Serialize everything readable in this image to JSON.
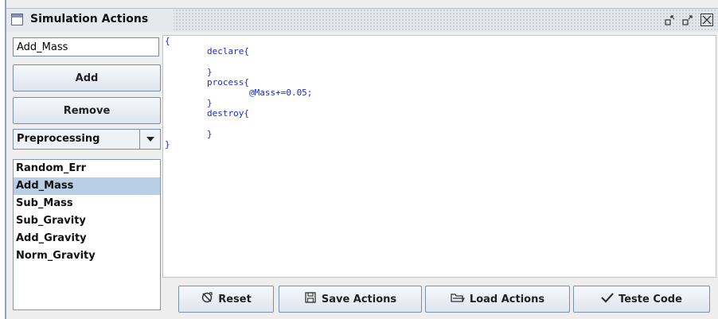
{
  "window": {
    "title": "Simulation Actions",
    "minimize_icon": "▫ʼ",
    "maximize_icon": "▫↗",
    "close_icon": "☒"
  },
  "left_panel": {
    "name_input_value": "Add_Mass",
    "add_label": "Add",
    "remove_label": "Remove",
    "stage_select": "Preprocessing",
    "actions": [
      "Random_Err",
      "Add_Mass",
      "Sub_Mass",
      "Sub_Gravity",
      "Add_Gravity",
      "Norm_Gravity"
    ],
    "selected_action": "Add_Mass"
  },
  "editor": {
    "code": "{\n        declare{\n\n        }\n        process{\n                @Mass+=0.05;\n        }\n        destroy{\n\n        }\n}"
  },
  "toolbar": {
    "reset_label": "Reset",
    "save_label": "Save Actions",
    "load_label": "Load Actions",
    "test_label": "Teste Code"
  },
  "icons": {
    "reset": "reset-icon",
    "save": "floppy-disk-icon",
    "load": "folder-open-icon",
    "test": "checkmark-icon"
  },
  "colors": {
    "code_text": "#1a2bd0",
    "selection": "#b8cfe5",
    "frame_accent": "#8fa3c8"
  }
}
